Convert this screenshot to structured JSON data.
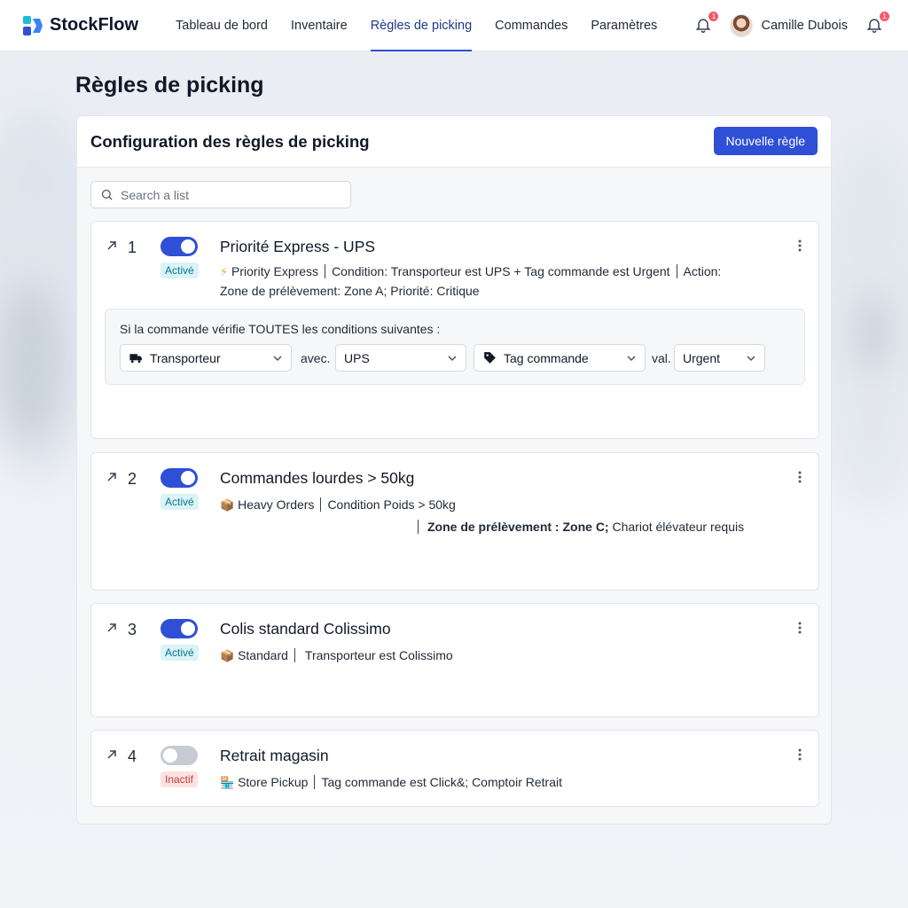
{
  "app": {
    "name": "StockFlow"
  },
  "nav": {
    "items": [
      {
        "label": "Tableau de bord"
      },
      {
        "label": "Inventaire"
      },
      {
        "label": "Règles de picking",
        "active": true
      },
      {
        "label": "Commandes"
      },
      {
        "label": "Paramètres"
      }
    ]
  },
  "header": {
    "notifications_count": "1",
    "alerts_count": "1",
    "user_name": "Camille Dubois"
  },
  "page": {
    "title": "Règles de picking",
    "panel_title": "Configuration des règles de picking",
    "new_rule_label": "Nouvelle règle",
    "search_placeholder": "Search a list"
  },
  "rules": [
    {
      "number": "1",
      "enabled": true,
      "status": "Activé",
      "title": "Priorité Express - UPS",
      "desc": {
        "icon": "⚡",
        "tag": "Priority Express",
        "condition": "Condition: Transporteur est UPS + Tag commande est Urgent",
        "action_label": "Action:",
        "action": "Zone de prélèvement: Zone A; Priorité: Critique"
      },
      "conditions": {
        "label": "Si la commande vérifie TOUTES les conditions suivantes :",
        "field1": "Transporteur",
        "joiner1": "avec.",
        "value1": "UPS",
        "field2": "Tag commande",
        "joiner2": "val.",
        "value2": "Urgent"
      }
    },
    {
      "number": "2",
      "enabled": true,
      "status": "Activé",
      "title": "Commandes lourdes > 50kg",
      "desc": {
        "icon": "📦",
        "tag": "Heavy Orders",
        "condition": "Condition Poids > 50kg",
        "action_bold": "Zone de prélèvement : Zone C;",
        "action": "Chariot élévateur requis"
      }
    },
    {
      "number": "3",
      "enabled": true,
      "status": "Activé",
      "title": "Colis standard Colissimo",
      "desc": {
        "icon": "📦",
        "tag": "Standard",
        "condition": "Transporteur est Colissimo"
      }
    },
    {
      "number": "4",
      "enabled": false,
      "status": "Inactif",
      "title": "Retrait magasin",
      "desc": {
        "icon": "🏪",
        "tag": "Store Pickup",
        "condition": "Tag commande est Click&; Comptoir Retrait"
      }
    }
  ],
  "colors": {
    "accent": "#2f4fd6",
    "active_badge": "#d9f3f7",
    "inactive_badge": "#fde2e2"
  },
  "icons": [
    "logo-icon",
    "bell-icon",
    "search-icon",
    "drag-arrow-icon",
    "kebab-icon",
    "truck-icon",
    "tag-icon",
    "chevron-down-icon"
  ]
}
